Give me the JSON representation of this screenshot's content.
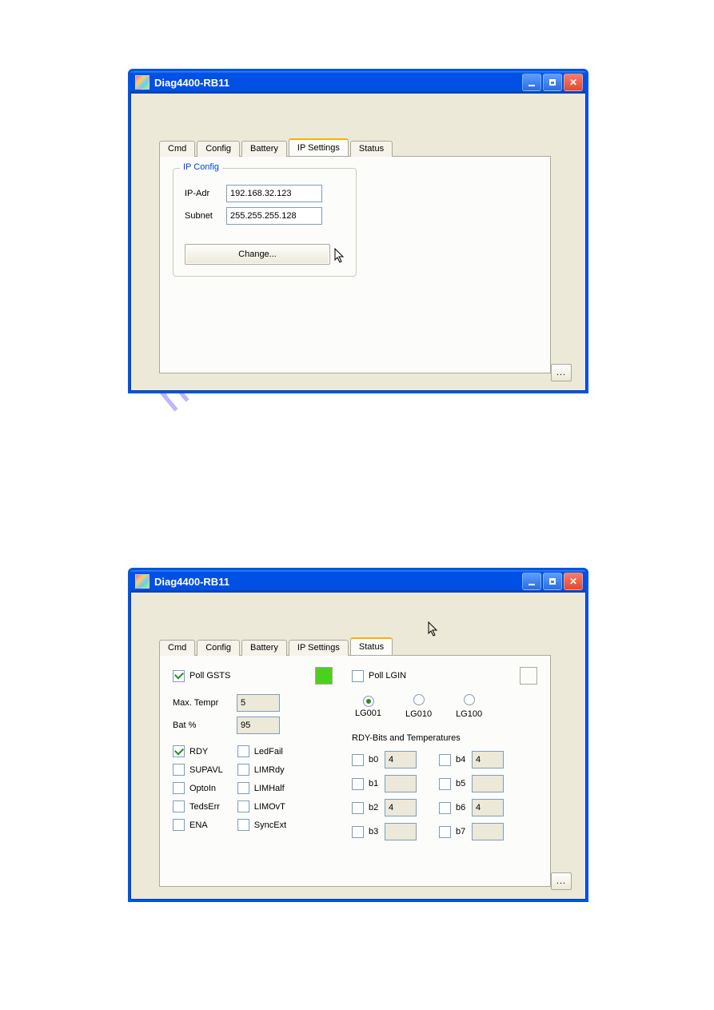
{
  "window": {
    "title": "Diag4400-RB11"
  },
  "tabs": {
    "cmd": "Cmd",
    "config": "Config",
    "battery": "Battery",
    "ip": "IP Settings",
    "status": "Status"
  },
  "ip": {
    "group_title": "IP Config",
    "ip_label": "IP-Adr",
    "ip_value": "192.168.32.123",
    "subnet_label": "Subnet",
    "subnet_value": "255.255.255.128",
    "change_btn": "Change..."
  },
  "status": {
    "poll_gsts": "Poll GSTS",
    "poll_lgin": "Poll LGIN",
    "max_t_label": "Max. Tempr",
    "max_t_value": "5",
    "bat_label": "Bat %",
    "bat_value": "95",
    "flags_left": [
      "RDY",
      "SUPAVL",
      "OptoIn",
      "TedsErr",
      "ENA"
    ],
    "flags_right": [
      "LedFail",
      "LIMRdy",
      "LIMHalf",
      "LIMOvT",
      "SyncExt"
    ],
    "lg": [
      "LG001",
      "LG010",
      "LG100"
    ],
    "rdy_title": "RDY-Bits and Temperatures",
    "bits_left": [
      {
        "n": "b0",
        "v": "4"
      },
      {
        "n": "b1",
        "v": ""
      },
      {
        "n": "b2",
        "v": "4"
      },
      {
        "n": "b3",
        "v": ""
      }
    ],
    "bits_right": [
      {
        "n": "b4",
        "v": "4"
      },
      {
        "n": "b5",
        "v": ""
      },
      {
        "n": "b6",
        "v": "4"
      },
      {
        "n": "b7",
        "v": ""
      }
    ]
  },
  "watermark": "manualshive.com"
}
